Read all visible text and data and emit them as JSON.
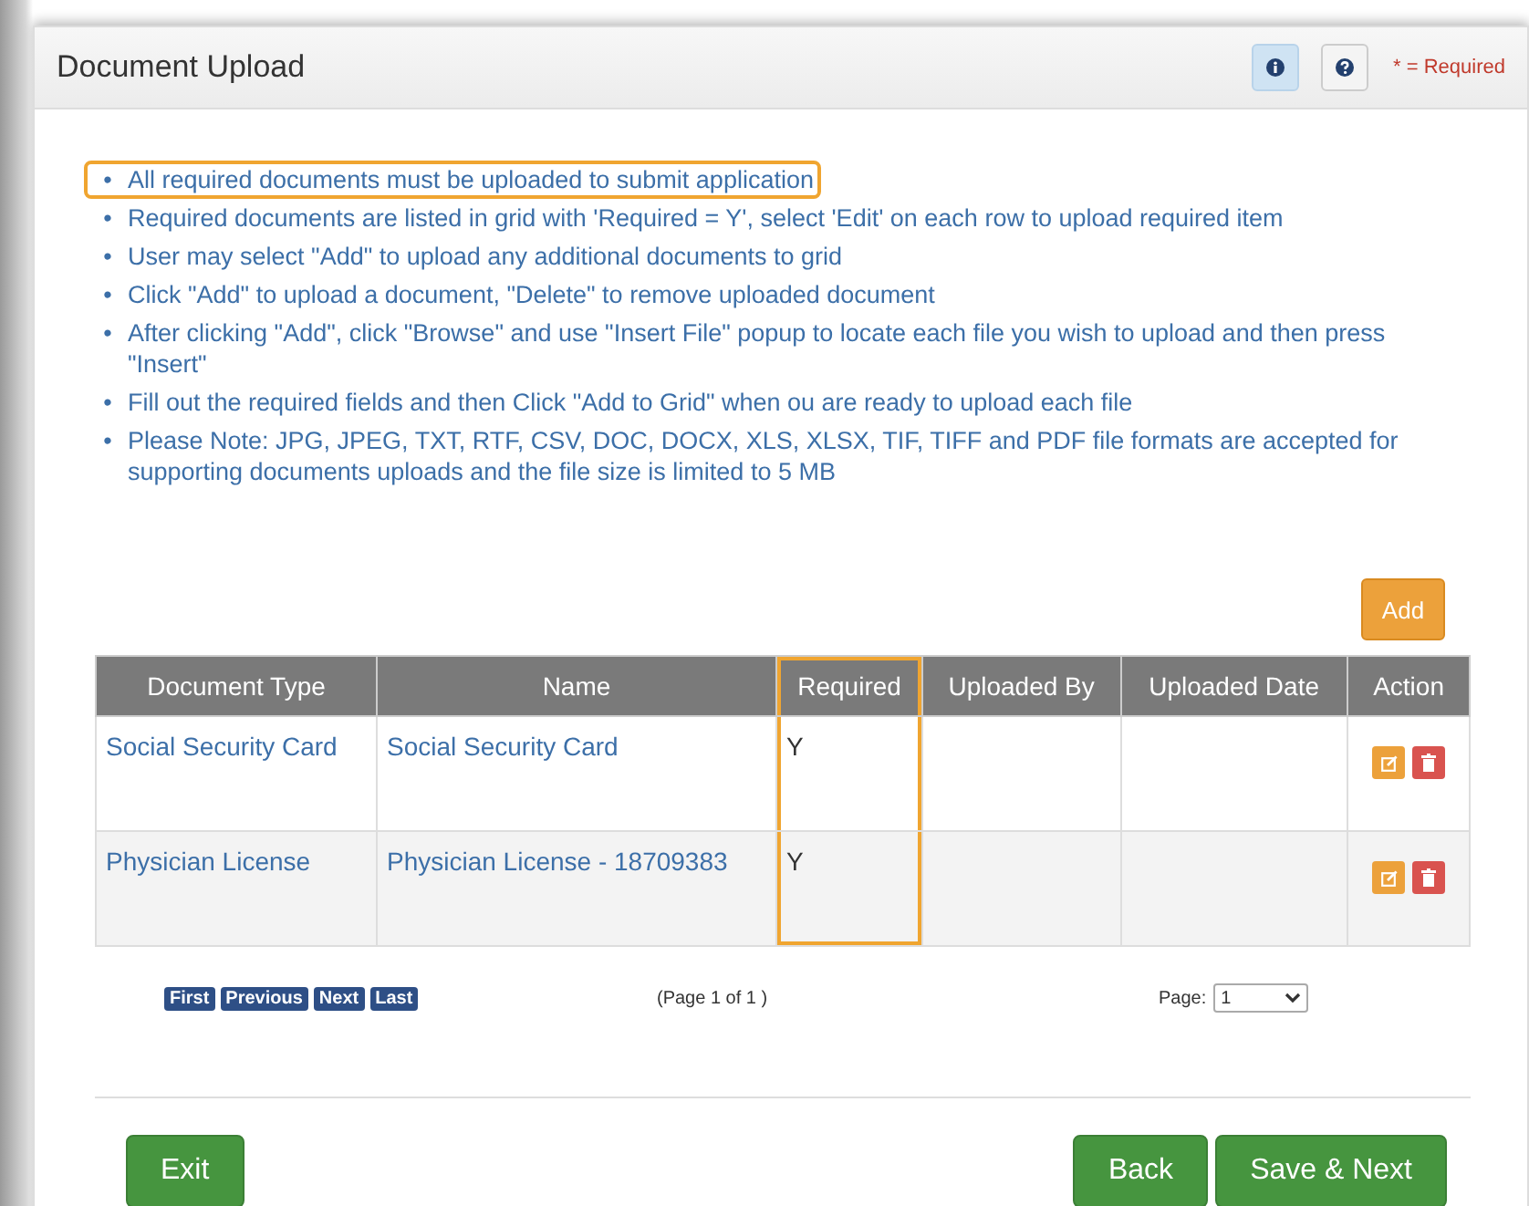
{
  "panel": {
    "title": "Document Upload",
    "required_note": "* = Required"
  },
  "instructions": [
    {
      "marker": "•",
      "text": "All required documents must be uploaded to submit application",
      "highlighted": true
    },
    {
      "marker": "•",
      "text": "Required documents are listed in grid with 'Required = Y', select 'Edit' on each row to upload required item",
      "highlighted": false
    },
    {
      "marker": "•",
      "text": "User may select \"Add\" to upload any additional documents to grid",
      "highlighted": false
    },
    {
      "marker": "•",
      "text": "Click \"Add\" to upload a document, \"Delete\" to remove uploaded document",
      "highlighted": false
    },
    {
      "marker": "•",
      "text": "After clicking \"Add\", click \"Browse\" and use \"Insert File\" popup to locate each file you wish to upload and then press \"Insert\"",
      "highlighted": false
    },
    {
      "marker": "•",
      "text": "Fill out the required fields and then Click \"Add to Grid\" when ou are ready to upload each file",
      "highlighted": false
    },
    {
      "marker": "•",
      "text": "Please Note: JPG, JPEG, TXT, RTF, CSV, DOC, DOCX, XLS, XLSX, TIF, TIFF and PDF file formats are accepted for supporting documents uploads and the file size is limited to 5 MB",
      "highlighted": false
    }
  ],
  "add_button": "Add",
  "table": {
    "columns": [
      {
        "label": "Document Type",
        "highlighted": false
      },
      {
        "label": "Name",
        "highlighted": false
      },
      {
        "label": "Required",
        "highlighted": true
      },
      {
        "label": "Uploaded By",
        "highlighted": false
      },
      {
        "label": "Uploaded Date",
        "highlighted": false
      },
      {
        "label": "Action",
        "highlighted": false
      }
    ],
    "rows": [
      {
        "document_type": "Social Security Card",
        "name": "Social Security Card",
        "required": "Y"
      },
      {
        "document_type": "Physician License",
        "name": "Physician License - 18709383",
        "required": "Y"
      }
    ]
  },
  "pager": {
    "buttons": [
      "First",
      "Previous",
      "Next",
      "Last"
    ],
    "info": "(Page 1 of 1 )",
    "page_label": "Page:",
    "page_value": "1"
  },
  "footer": {
    "left": [
      "Exit"
    ],
    "right": [
      "Back",
      "Save & Next"
    ]
  }
}
